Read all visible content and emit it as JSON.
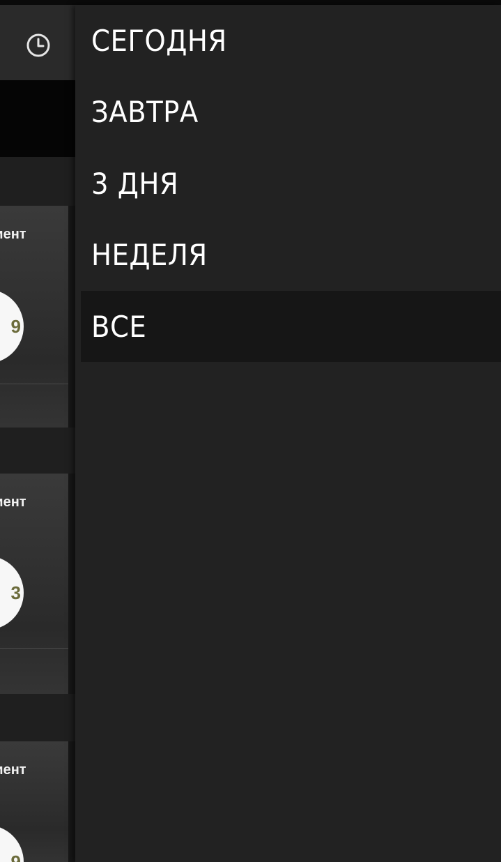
{
  "background_app": {
    "clock_icon": "clock-icon",
    "cards": [
      {
        "label": "циент",
        "badge_text": "9"
      },
      {
        "label": "циент",
        "badge_text": "3"
      },
      {
        "label": "циент",
        "badge_text": "9"
      }
    ]
  },
  "drawer": {
    "items": [
      {
        "label": "СЕГОДНЯ",
        "selected": false
      },
      {
        "label": "ЗАВТРА",
        "selected": false
      },
      {
        "label": "3 ДНЯ",
        "selected": false
      },
      {
        "label": "НЕДЕЛЯ",
        "selected": false
      },
      {
        "label": "ВСЕ",
        "selected": true
      }
    ]
  },
  "colors": {
    "drawer_bg": "#222222",
    "selected_bg": "#161616",
    "text": "#ffffff",
    "header_bg": "#2a2a2a"
  }
}
